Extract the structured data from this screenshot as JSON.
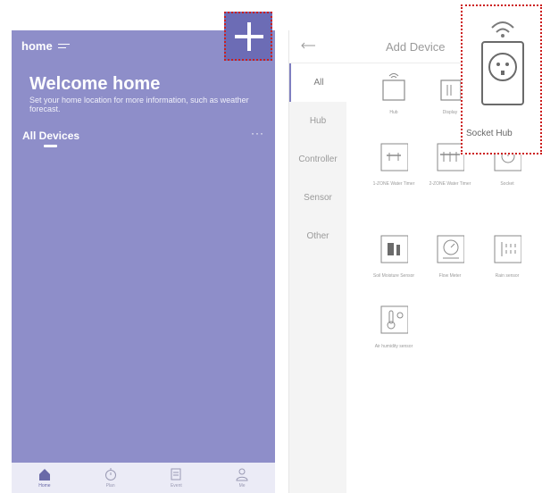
{
  "home_screen": {
    "home_label": "home",
    "welcome_title": "Welcome home",
    "welcome_subtitle": "Set your home location for more information, such as weather forecast.",
    "section_title": "All Devices",
    "more_label": "···",
    "nav": [
      {
        "label": "Home",
        "icon": "home-icon"
      },
      {
        "label": "Plan",
        "icon": "timer-icon"
      },
      {
        "label": "Event",
        "icon": "document-icon"
      },
      {
        "label": "Me",
        "icon": "person-icon"
      }
    ]
  },
  "add_device": {
    "title": "Add Device",
    "categories": [
      "All",
      "Hub",
      "Controller",
      "Sensor",
      "Other"
    ],
    "devices": [
      {
        "label": "Hub",
        "icon": "hub-icon"
      },
      {
        "label": "Display",
        "icon": "display-icon"
      },
      {
        "label": "1-ZONE Water Timer",
        "icon": "water-timer-icon"
      },
      {
        "label": "2-ZONE Water Timer",
        "icon": "water-timer-2-icon"
      },
      {
        "label": "Socket",
        "icon": "socket-icon"
      },
      {
        "label": "Soil Moisture Sensor",
        "icon": "soil-moisture-icon"
      },
      {
        "label": "Flow Meter",
        "icon": "flow-meter-icon"
      },
      {
        "label": "Rain sensor",
        "icon": "rain-sensor-icon"
      },
      {
        "label": "Air humidity sensor",
        "icon": "air-humidity-icon"
      }
    ]
  },
  "callout": {
    "label": "Socket Hub",
    "icon": "socket-hub-icon"
  },
  "colors": {
    "theme_purple": "#8e8ec9",
    "highlight_red": "#cc1f1f",
    "icon_gray": "#8a8a8a"
  }
}
